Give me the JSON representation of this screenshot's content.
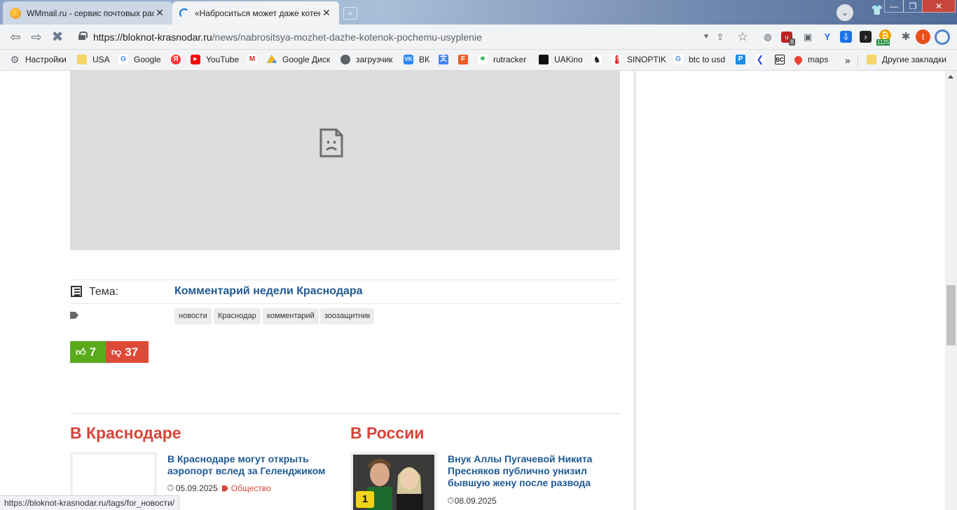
{
  "browser": {
    "tabs": [
      {
        "title": "WMmail.ru - сервис почтовых рассылок",
        "close": "✕"
      },
      {
        "title": "«Наброситься может даже котенок»: почему усиление",
        "close": "✕"
      }
    ],
    "new_tab": "+",
    "url_host": "https://bloknot-krasnodar.ru",
    "url_path": "/news/nabrositsya-mozhet-dazhe-kotenok-pochemu-usyplenie",
    "extension_badge_u": "8",
    "extension_badge_price": "1125",
    "profile_initial": "I",
    "window_controls": [
      "—",
      "❐",
      "✕"
    ]
  },
  "bookmarks": [
    {
      "label": "Настройки",
      "icon": "gear-icon"
    },
    {
      "label": "USA",
      "icon": "folder-icon"
    },
    {
      "label": "Google",
      "icon": "google-icon"
    },
    {
      "label": "",
      "icon": "yandex-icon"
    },
    {
      "label": "YouTube",
      "icon": "youtube-icon"
    },
    {
      "label": "",
      "icon": "gmail-icon"
    },
    {
      "label": "Google Диск",
      "icon": "drive-icon"
    },
    {
      "label": "загрузчик",
      "icon": "globe-icon"
    },
    {
      "label": "ВК",
      "icon": "vk-icon"
    },
    {
      "label": "",
      "icon": "translate-icon"
    },
    {
      "label": "",
      "icon": "f-icon"
    },
    {
      "label": "rutracker",
      "icon": "rutracker-icon"
    },
    {
      "label": "UAKino",
      "icon": "film-icon"
    },
    {
      "label": "",
      "icon": "chess-icon"
    },
    {
      "label": "SINOPTIK",
      "icon": "thermometer-icon"
    },
    {
      "label": "btc to usd",
      "icon": "google-icon"
    },
    {
      "label": "",
      "icon": "p-icon"
    },
    {
      "label": "",
      "icon": "arrow-icon"
    },
    {
      "label": "",
      "icon": "bc-icon"
    },
    {
      "label": "maps",
      "icon": "maps-icon"
    }
  ],
  "bookmarks_more": "»",
  "other_bookmarks": "Другие закладки",
  "article": {
    "topic_label": "Тема:",
    "topic_link": "Комментарий недели Краснодара",
    "tags": [
      "новости",
      "Краснодар",
      "комментарий",
      "зоозащитник"
    ],
    "likes": "7",
    "dislikes": "37"
  },
  "sections": {
    "local": {
      "title": "В Краснодаре",
      "news": {
        "title": "В Краснодаре могут открыть аэропорт вслед за Геленджиком",
        "date": "05.09.2025",
        "category": "Общество"
      }
    },
    "russia": {
      "title": "В России",
      "news": {
        "title": "Внук Аллы Пугачевой Никита Пресняков публично унизил бывшую жену после развода",
        "date": "08.09.2025",
        "badge": "1"
      }
    }
  },
  "status_url": "https://bloknot-krasnodar.ru/tags/for_новости/"
}
